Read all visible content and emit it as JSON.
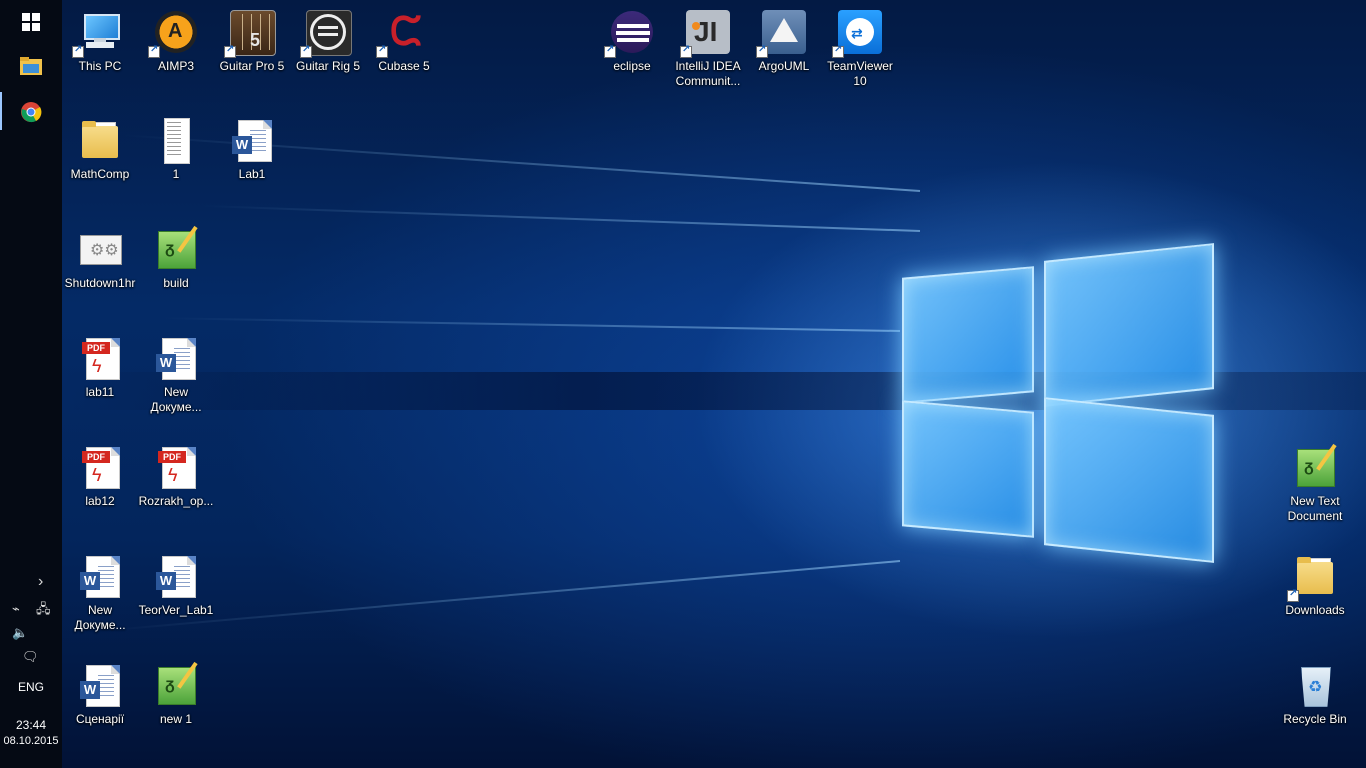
{
  "taskbar": {
    "clock_time": "23:44",
    "clock_date": "08.10.2015",
    "language": "ENG",
    "pinned": [
      {
        "name": "start-button",
        "icon": "windows-logo-icon"
      },
      {
        "name": "file-explorer",
        "icon": "folder-icon"
      },
      {
        "name": "chrome",
        "icon": "chrome-icon"
      }
    ]
  },
  "desktop": {
    "icons": {
      "this_pc": "This PC",
      "aimp3": "AIMP3",
      "guitar_pro_5": "Guitar Pro 5",
      "guitar_rig_5": "Guitar Rig 5",
      "cubase_5": "Cubase 5",
      "eclipse": "eclipse",
      "intellij": "IntelliJ IDEA Communit...",
      "argouml": "ArgoUML",
      "teamviewer": "TeamViewer 10",
      "mathcomp": "MathComp",
      "file_1": "1",
      "lab1": "Lab1",
      "shutdown1hr": "Shutdown1hr",
      "build": "build",
      "lab11": "lab11",
      "new_doc_1": "New Докуме...",
      "lab12": "lab12",
      "rozrakh": "Rozrakh_op...",
      "new_doc_2": "New Докуме...",
      "teorver_lab1": "TeorVer_Lab1",
      "stsenarii": "Сценарії",
      "new_1": "new 1",
      "new_text_document": "New Text Document",
      "downloads": "Downloads",
      "recycle_bin": "Recycle Bin"
    }
  },
  "colors": {
    "taskbar_bg": "#050a14",
    "desktop_accent": "#2a8cf0",
    "word_blue": "#2b579a",
    "pdf_red": "#d4271f"
  }
}
